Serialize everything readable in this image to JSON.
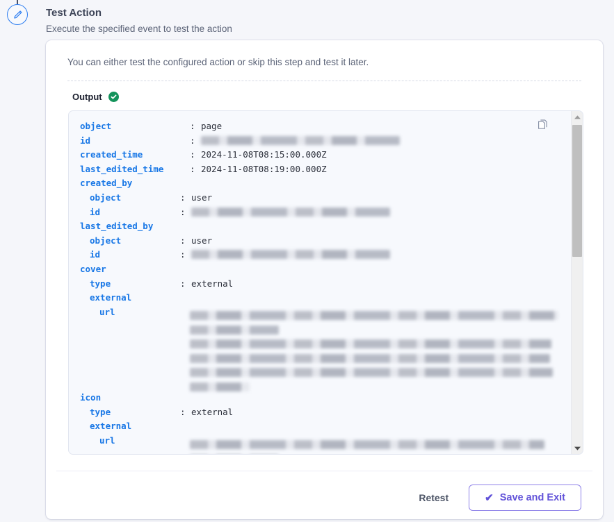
{
  "step": {
    "icon": "pencil-icon",
    "title": "Test Action",
    "subtitle": "Execute the specified event to test the action"
  },
  "card": {
    "intro": "You can either test the configured action or skip this step and test it later."
  },
  "tab": {
    "label": "Output",
    "status_icon": "check-circle-icon",
    "status_color": "#13935b"
  },
  "code_panel": {
    "copy_icon": "copy-icon",
    "lines": [
      {
        "key": "object",
        "indent": 0,
        "colon": ":",
        "value": "page",
        "redacted": false
      },
      {
        "key": "id",
        "indent": 0,
        "colon": ":",
        "value": "",
        "redacted": true
      },
      {
        "key": "created_time",
        "indent": 0,
        "colon": ":",
        "value": "2024-11-08T08:15:00.000Z",
        "redacted": false
      },
      {
        "key": "last_edited_time",
        "indent": 0,
        "colon": ":",
        "value": "2024-11-08T08:19:00.000Z",
        "redacted": false
      },
      {
        "key": "created_by",
        "indent": 0,
        "colon": "",
        "value": "",
        "redacted": false
      },
      {
        "key": "object",
        "indent": 1,
        "colon": ":",
        "value": "user",
        "redacted": false
      },
      {
        "key": "id",
        "indent": 1,
        "colon": ":",
        "value": "",
        "redacted": true
      },
      {
        "key": "last_edited_by",
        "indent": 0,
        "colon": "",
        "value": "",
        "redacted": false
      },
      {
        "key": "object",
        "indent": 1,
        "colon": ":",
        "value": "user",
        "redacted": false
      },
      {
        "key": "id",
        "indent": 1,
        "colon": ":",
        "value": "",
        "redacted": true
      },
      {
        "key": "cover",
        "indent": 0,
        "colon": "",
        "value": "",
        "redacted": false
      },
      {
        "key": "type",
        "indent": 1,
        "colon": ":",
        "value": "external",
        "redacted": false
      },
      {
        "key": "external",
        "indent": 1,
        "colon": "",
        "value": "",
        "redacted": false
      },
      {
        "key": "url",
        "indent": 2,
        "colon": "",
        "value": "",
        "redacted": true
      },
      {
        "key": "",
        "indent": 0,
        "colon": "",
        "value": "",
        "redacted": false
      },
      {
        "key": "",
        "indent": 0,
        "colon": "",
        "value": "",
        "redacted": false
      },
      {
        "key": "",
        "indent": 0,
        "colon": "",
        "value": "",
        "redacted": false
      },
      {
        "key": "",
        "indent": 0,
        "colon": "",
        "value": "",
        "redacted": false
      },
      {
        "key": "",
        "indent": 0,
        "colon": "",
        "value": "",
        "redacted": false
      },
      {
        "key": "icon",
        "indent": 0,
        "colon": "",
        "value": "",
        "redacted": false
      },
      {
        "key": "type",
        "indent": 1,
        "colon": ":",
        "value": "external",
        "redacted": false
      },
      {
        "key": "external",
        "indent": 1,
        "colon": "",
        "value": "",
        "redacted": false
      },
      {
        "key": "url",
        "indent": 2,
        "colon": "",
        "value": "",
        "redacted": true
      }
    ],
    "scrollbar": {
      "up_arrow": "triangle-up-icon",
      "down_arrow": "triangle-down-icon"
    }
  },
  "footer": {
    "retest_label": "Retest",
    "save_label": "Save and Exit",
    "save_tick": "✔",
    "accent_color": "#6152d9"
  }
}
